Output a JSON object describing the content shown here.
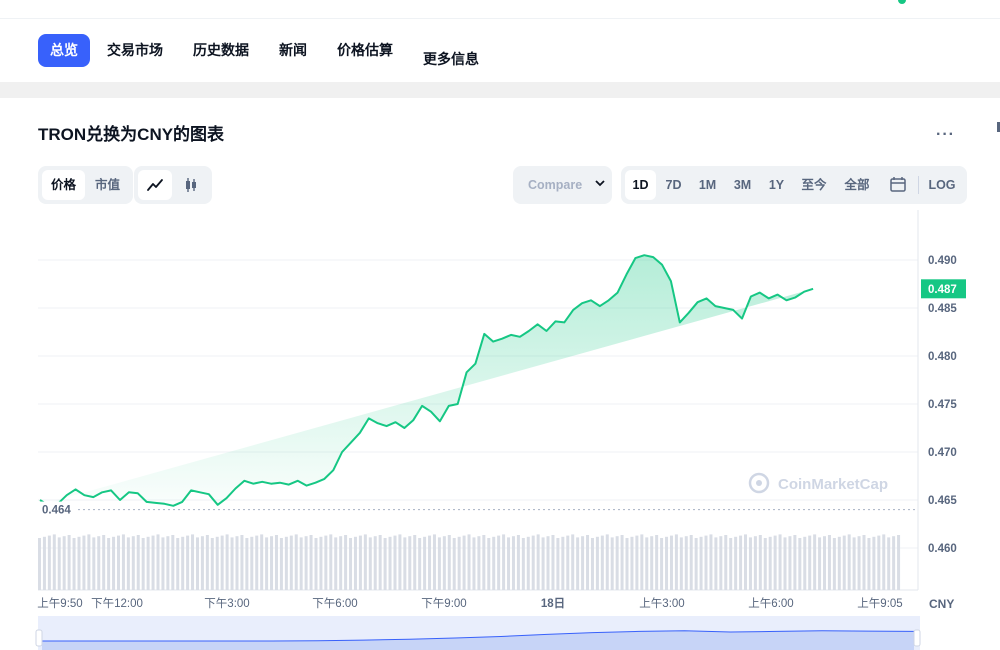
{
  "nav": {
    "tabs": [
      {
        "label": "总览",
        "active": true
      },
      {
        "label": "交易市场",
        "active": false
      },
      {
        "label": "历史数据",
        "active": false
      },
      {
        "label": "新闻",
        "active": false
      },
      {
        "label": "价格估算",
        "active": false
      },
      {
        "label": "更多信息",
        "active": false
      }
    ]
  },
  "section": {
    "title": "TRON兑换为CNY的图表",
    "more_label": "···"
  },
  "controls": {
    "metric_options": [
      "价格",
      "市值"
    ],
    "metric_selected": "价格",
    "chart_styles": [
      "line-chart-icon",
      "candlestick-icon"
    ],
    "compare_label": "Compare",
    "ranges": [
      "1D",
      "7D",
      "1M",
      "3M",
      "1Y",
      "至今",
      "全部"
    ],
    "range_selected": "1D",
    "log_label": "LOG"
  },
  "chart_data": {
    "type": "line",
    "ylim": [
      0.4585,
      0.4935
    ],
    "yticks": [
      0.49,
      0.485,
      0.48,
      0.475,
      0.47,
      0.465,
      0.46
    ],
    "ytick_labels": [
      "0.490",
      "0.485",
      "0.480",
      "0.475",
      "0.470",
      "0.465",
      "0.460"
    ],
    "current_value": "0.487",
    "open_value": "0.464",
    "xtick_labels": [
      "上午9:50",
      "下午12:00",
      "下午3:00",
      "下午6:00",
      "下午9:00",
      "18日",
      "上午3:00",
      "上午6:00",
      "上午9:05"
    ],
    "currency_label": "CNY",
    "watermark": "CoinMarketCap",
    "line_color": "#16c784",
    "series": [
      {
        "x_hours": [
          0,
          0.25,
          0.5,
          0.75,
          1,
          1.25,
          1.5,
          1.75,
          2,
          2.25,
          2.5,
          2.75,
          3,
          3.25,
          3.5,
          3.75,
          4,
          4.25,
          4.5,
          4.75,
          5,
          5.25,
          5.5,
          5.75,
          6,
          6.25,
          6.5,
          6.75,
          7,
          7.25,
          7.5,
          7.75,
          8,
          8.25,
          8.5,
          8.75,
          9,
          9.25,
          9.5,
          9.75,
          10,
          10.25,
          10.5,
          10.75,
          11,
          11.25,
          11.5,
          11.75,
          12,
          12.25,
          12.5,
          12.75,
          13,
          13.25,
          13.5,
          13.75,
          14,
          14.25,
          14.5,
          14.75,
          15,
          15.25,
          15.5,
          15.75,
          16,
          16.25,
          16.5,
          16.75,
          17,
          17.25,
          17.5,
          17.75,
          18,
          18.25,
          18.5,
          18.75,
          19,
          19.25,
          19.5,
          19.75,
          20,
          20.25,
          20.5,
          20.75,
          21,
          21.25,
          21.5,
          21.75,
          22,
          22.25,
          22.5,
          22.75,
          23,
          23.25,
          23.5,
          23.75,
          24,
          24.25
        ],
        "values": [
          0.465,
          0.4644,
          0.4646,
          0.4655,
          0.4661,
          0.4655,
          0.4653,
          0.4658,
          0.466,
          0.465,
          0.4658,
          0.4657,
          0.4648,
          0.4647,
          0.4646,
          0.4644,
          0.4648,
          0.466,
          0.4658,
          0.4656,
          0.4645,
          0.4652,
          0.4662,
          0.467,
          0.4667,
          0.4669,
          0.4667,
          0.4668,
          0.4666,
          0.467,
          0.4665,
          0.4668,
          0.4672,
          0.4681,
          0.47,
          0.471,
          0.472,
          0.4735,
          0.473,
          0.4727,
          0.4731,
          0.4725,
          0.4733,
          0.4748,
          0.4742,
          0.4732,
          0.4748,
          0.475,
          0.4783,
          0.4792,
          0.4823,
          0.4815,
          0.4818,
          0.4822,
          0.482,
          0.4826,
          0.4833,
          0.4826,
          0.4836,
          0.4835,
          0.4848,
          0.4855,
          0.4858,
          0.4852,
          0.4858,
          0.4866,
          0.4885,
          0.4902,
          0.4905,
          0.4903,
          0.4895,
          0.4878,
          0.4835,
          0.4845,
          0.4856,
          0.486,
          0.4852,
          0.485,
          0.4848,
          0.4839,
          0.4862,
          0.4866,
          0.486,
          0.4864,
          0.4858,
          0.4861,
          0.4867,
          0.487
        ],
        "volume_rel": 0.6
      }
    ],
    "navigator_series": [
      0.3,
      0.3,
      0.3,
      0.3,
      0.3,
      0.3,
      0.31,
      0.33,
      0.36,
      0.4,
      0.45,
      0.52,
      0.58,
      0.62,
      0.64,
      0.6,
      0.62,
      0.64,
      0.63,
      0.62
    ]
  }
}
